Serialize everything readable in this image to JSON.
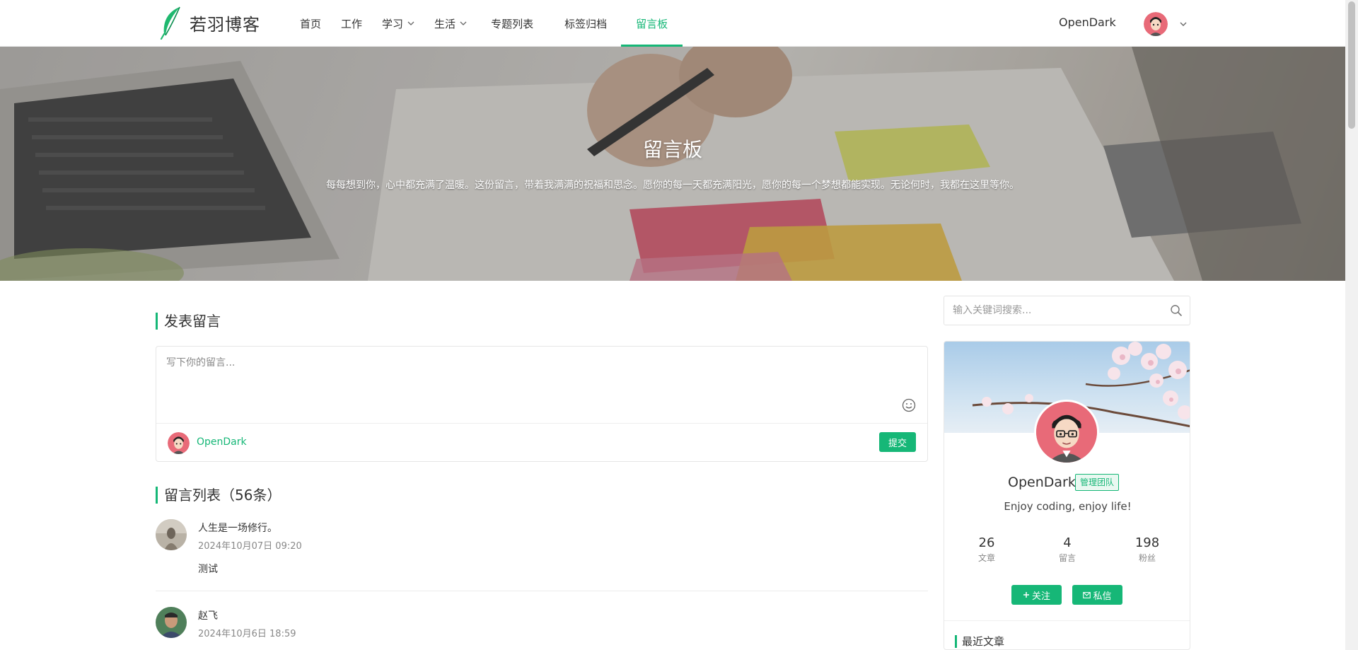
{
  "brand": {
    "name": "若羽博客",
    "logo_icon": "feather-icon"
  },
  "nav": {
    "items": [
      {
        "label": "首页",
        "has_dropdown": false,
        "active": false
      },
      {
        "label": "工作",
        "has_dropdown": false,
        "active": false
      },
      {
        "label": "学习",
        "has_dropdown": true,
        "active": false
      },
      {
        "label": "生活",
        "has_dropdown": true,
        "active": false
      },
      {
        "label": "专题列表",
        "has_dropdown": false,
        "active": false
      },
      {
        "label": "标签归档",
        "has_dropdown": false,
        "active": false
      },
      {
        "label": "留言板",
        "has_dropdown": false,
        "active": true
      }
    ],
    "username": "OpenDark"
  },
  "banner": {
    "title": "留言板",
    "subtitle": "每每想到你，心中都充满了温暖。这份留言，带着我满满的祝福和思念。愿你的每一天都充满阳光，愿你的每一个梦想都能实现。无论何时，我都在这里等你。"
  },
  "post_form": {
    "section_title": "发表留言",
    "placeholder": "写下你的留言...",
    "author": "OpenDark",
    "submit_label": "提交"
  },
  "message_list": {
    "title": "留言列表（56条）",
    "items": [
      {
        "name": "人生是一场修行。",
        "time": "2024年10月07日 09:20",
        "text": "测试"
      },
      {
        "name": "赵飞",
        "time": "2024年10月6日 18:59",
        "text": ""
      }
    ]
  },
  "sidebar": {
    "search_placeholder": "输入关键词搜索...",
    "profile": {
      "name": "OpenDark",
      "badge": "管理团队",
      "motto": "Enjoy coding, enjoy life!",
      "stats": [
        {
          "value": "26",
          "label": "文章"
        },
        {
          "value": "4",
          "label": "留言"
        },
        {
          "value": "198",
          "label": "粉丝"
        }
      ],
      "follow_label": "关注",
      "message_label": "私信"
    },
    "recent_title": "最近文章"
  },
  "colors": {
    "accent": "#16b777",
    "text": "#333333",
    "muted": "#888888"
  }
}
